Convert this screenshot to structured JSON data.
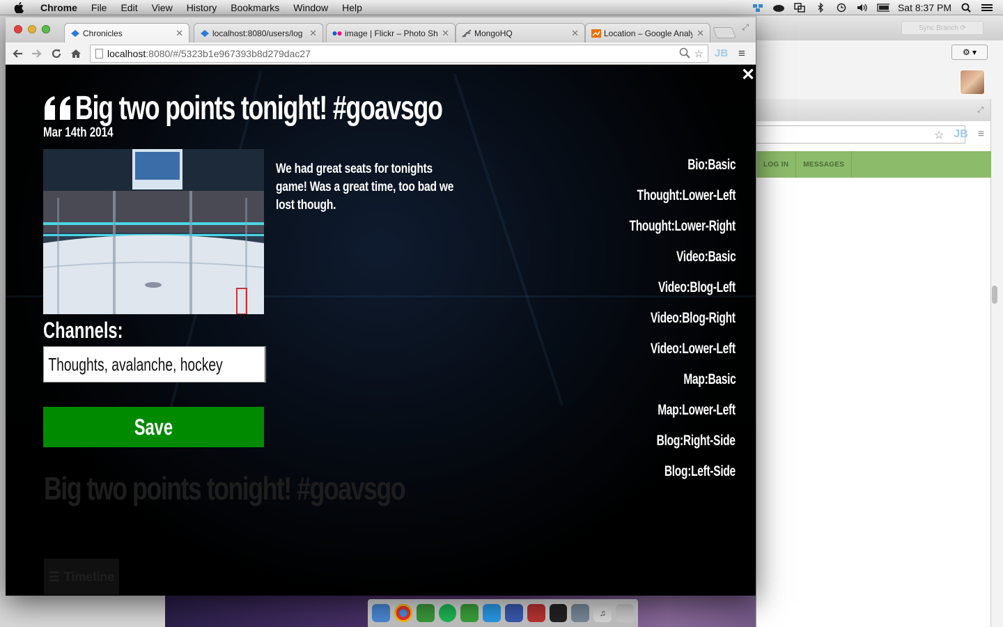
{
  "menubar": {
    "app": "Chrome",
    "items": [
      "File",
      "Edit",
      "View",
      "History",
      "Bookmarks",
      "Window",
      "Help"
    ],
    "clock": "Sat 8:37 PM"
  },
  "browser": {
    "tabs": [
      {
        "title": "Chronicles",
        "icon": "chronicles-favicon",
        "active": true
      },
      {
        "title": "localhost:8080/users/log",
        "icon": "chronicles-favicon",
        "active": false
      },
      {
        "title": "image | Flickr – Photo Sh",
        "icon": "flickr-favicon",
        "active": false
      },
      {
        "title": "MongoHQ",
        "icon": "mongohq-favicon",
        "active": false
      },
      {
        "title": "Location – Google Analyt",
        "icon": "analytics-favicon",
        "active": false
      }
    ],
    "url_host": "localhost",
    "url_path": ":8080/#/5323b1e967393b8d279dac27",
    "extension_label": "JB"
  },
  "post": {
    "title": "Big two points tonight! #goavsgo",
    "date": "Mar 14th 2014",
    "caption": "We had great seats for tonights game! Was a great time, too bad we lost though.",
    "channels_label": "Channels:",
    "channels_value": "Thoughts, avalanche, hockey",
    "save_label": "Save",
    "layouts": [
      "Bio:Basic",
      "Thought:Lower-Left",
      "Thought:Lower-Right",
      "Video:Basic",
      "Video:Blog-Left",
      "Video:Blog-Right",
      "Video:Lower-Left",
      "Map:Basic",
      "Map:Lower-Left",
      "Blog:Right-Side",
      "Blog:Left-Side"
    ]
  },
  "background_page": {
    "title": "Big two points tonight! #goavsgo",
    "timeline_label": "Timeline"
  },
  "second_window": {
    "sync_label": "Sync Branch",
    "nav": [
      "LOG IN",
      "MESSAGES"
    ],
    "extension_label": "JB"
  },
  "colors": {
    "save_green": "#008a00",
    "nav_green": "#8cbb6a"
  }
}
